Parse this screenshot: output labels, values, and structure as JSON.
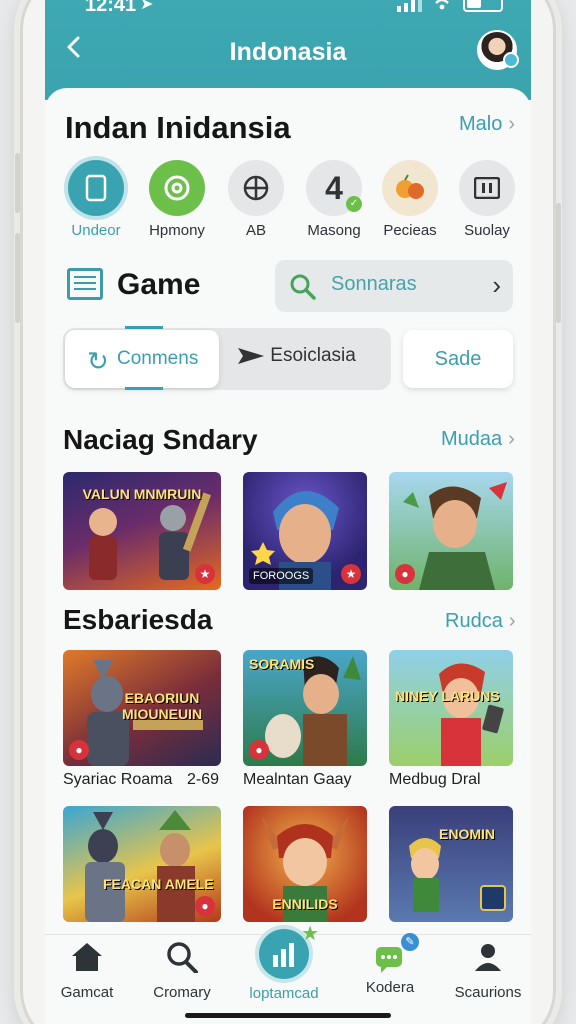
{
  "status": {
    "time": "12:41"
  },
  "header": {
    "title": "Indonasia"
  },
  "hero": {
    "title": "Indan Inidansia",
    "more_label": "Malo"
  },
  "categories": [
    {
      "label": "Undeor",
      "icon": "tablet-icon"
    },
    {
      "label": "Hpmony",
      "icon": "spiral-icon"
    },
    {
      "label": "AB",
      "icon": "globe-icon"
    },
    {
      "label": "Masong",
      "icon": "number-four-icon",
      "glyph": "4"
    },
    {
      "label": "Pecieas",
      "icon": "fruit-icon"
    },
    {
      "label": "Suolay",
      "icon": "pause-icon"
    }
  ],
  "game": {
    "title": "Game",
    "search_text": "Sonnaras"
  },
  "tabs": [
    {
      "label": "Conmens"
    },
    {
      "label": "Esoiclasia"
    },
    {
      "label": "Sade"
    }
  ],
  "section1": {
    "title": "Naciag Sndary",
    "more_label": "Mudaa",
    "tiles": [
      {
        "art_text": "VALUN MNMRUIN"
      },
      {
        "art_text": "FOROOGS"
      },
      {
        "art_text": ""
      }
    ]
  },
  "section2": {
    "title": "Esbariesda",
    "more_label": "Rudca",
    "items": [
      {
        "caption": "Syariac Roama",
        "count": "2-69",
        "art_text": "EBAORIUN MIOUNEUIN"
      },
      {
        "caption": "Mealntan Gaay",
        "art_text": "SORAMIS"
      },
      {
        "caption": "Medbug Dral",
        "art_text": "NINEY LARUNS"
      }
    ],
    "row2": [
      {
        "art_text": "FEACAN AMELE"
      },
      {
        "art_text": "ENNILIDS"
      },
      {
        "art_text": "ENOMIN"
      }
    ]
  },
  "nav": [
    {
      "label": "Gamcat",
      "icon": "home-icon"
    },
    {
      "label": "Cromary",
      "icon": "search-icon"
    },
    {
      "label": "loptamcad",
      "icon": "chart-icon"
    },
    {
      "label": "Kodera",
      "icon": "chat-icon"
    },
    {
      "label": "Scaurions",
      "icon": "person-icon"
    }
  ],
  "colors": {
    "accent": "#3a9fb0",
    "header": "#3ea8b3",
    "badge": "#d8323a"
  }
}
